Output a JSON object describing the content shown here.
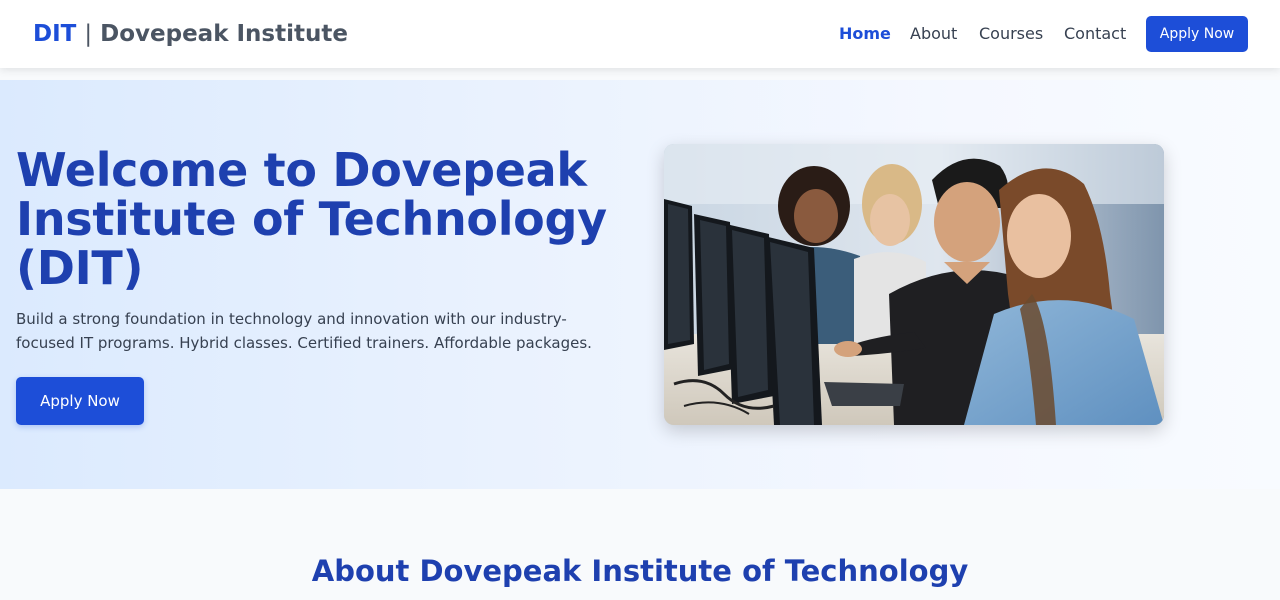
{
  "header": {
    "brand_abbr": "DIT",
    "brand_sep": "|",
    "brand_name": "Dovepeak Institute",
    "nav": [
      {
        "label": "Home",
        "active": true
      },
      {
        "label": "About"
      },
      {
        "label": "Courses"
      },
      {
        "label": "Contact"
      }
    ],
    "cta_label": "Apply Now"
  },
  "hero": {
    "title": "Welcome to Dovepeak Institute of Technology (DIT)",
    "description": "Build a strong foundation in technology and innovation with our industry-focused IT programs. Hybrid classes. Certified trainers. Affordable packages.",
    "cta_label": "Apply Now",
    "image_subject": "students-at-computer-lab-photo"
  },
  "about": {
    "title": "About Dovepeak Institute of Technology"
  },
  "colors": {
    "accent": "#1d4ed8",
    "heading": "#1e40af",
    "hero_bg_start": "#dbeafe",
    "page_bg": "#f8fafc"
  }
}
